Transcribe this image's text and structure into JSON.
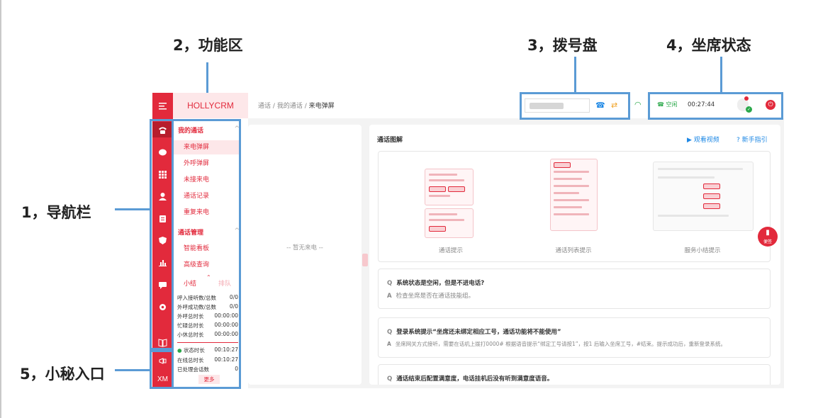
{
  "callouts": {
    "nav": "1，导航栏",
    "func": "2，功能区",
    "dial": "3，拨号盘",
    "seat": "4，坐席状态",
    "assistant": "5，小秘入口"
  },
  "app": {
    "brand": "HOLLYCRM",
    "accent": "#e22a3c",
    "breadcrumb": {
      "root": "通话",
      "mid": "我的通话",
      "current": "来电弹屏",
      "sep": "/"
    },
    "seat_status": {
      "label": "空闲",
      "timer": "00:27:44"
    },
    "rail_bottom_label": "XM"
  },
  "sidebar": {
    "group1": "我的通话",
    "items1": [
      "来电弹屏",
      "外呼弹屏",
      "未接来电",
      "通话记录",
      "重复来电"
    ],
    "group2": "通话管理",
    "items2": [
      "智能看板",
      "高级查询"
    ],
    "tabs": [
      "小结",
      "排队"
    ],
    "stats": [
      {
        "label": "呼入接听数/总数",
        "value": "0/0"
      },
      {
        "label": "外呼成功数/总数",
        "value": "0/0"
      },
      {
        "label": "外呼总时长",
        "value": "00:00:00"
      },
      {
        "label": "忙碌总时长",
        "value": "00:00:00"
      },
      {
        "label": "小休总时长",
        "value": "00:00:00"
      }
    ],
    "stats2": [
      {
        "label": "状态时长",
        "value": "00:10:27"
      },
      {
        "label": "在线总时长",
        "value": "00:10:27"
      },
      {
        "label": "已处理会话数",
        "value": "0"
      }
    ],
    "more": "更多"
  },
  "left_card": {
    "empty": "-- 暂无来电 --"
  },
  "right_card": {
    "title": "通话图解",
    "video_link": "观看视频",
    "guide_link": "新手指引",
    "captions": [
      "通话提示",
      "通话列表提示",
      "服务小结提示"
    ],
    "badge": "便签",
    "faqs": [
      {
        "q": "系统状态是空闲，但是不进电话?",
        "a": "检查坐席是否在通话技能组。"
      },
      {
        "q": "登录系统提示“坐席还未绑定相应工号，通话功能将不能使用”",
        "a": "坐席网关方式接听，需要在话机上拨打0000# 根据语音提示“绑定工号请按1”，按1 后输入坐席工号，#结束。提示成功后，重新登录系统。"
      },
      {
        "q": "通话结束后配置满意度，电话挂机后没有听到满意度语音。",
        "a": ""
      }
    ],
    "q_mark": "Q",
    "a_mark": "A"
  }
}
